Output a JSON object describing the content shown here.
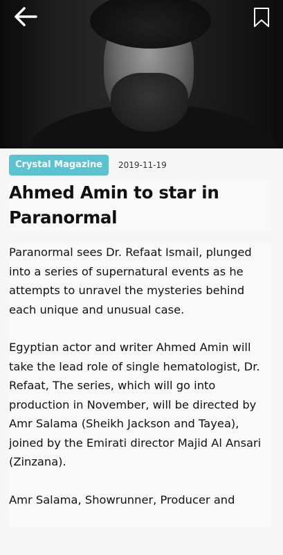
{
  "header": {
    "back_icon": "arrow-left-icon",
    "bookmark_icon": "bookmark-icon"
  },
  "article": {
    "source": "Crystal Magazine",
    "date": "2019-11-19",
    "title": "Ahmed Amin to star in Paranormal",
    "paragraphs": [
      "Paranormal sees Dr. Refaat Ismail, plunged into a series of supernatural events as he attempts to unravel the mysteries behind each unique and unusual case.",
      "Egyptian actor and writer Ahmed Amin will take the lead role of single hematologist, Dr. Refaat, The series, which will go into production in November, will be directed by Amr Salama (Sheikh Jackson and Tayea), joined by the Emirati director Majid Al Ansari (Zinzana).",
      "Amr Salama, Showrunner, Producer and"
    ]
  },
  "colors": {
    "badge_bg": "#5bc3cf",
    "badge_text": "#ffffff",
    "background": "#f6f6f6",
    "text": "#111111"
  }
}
